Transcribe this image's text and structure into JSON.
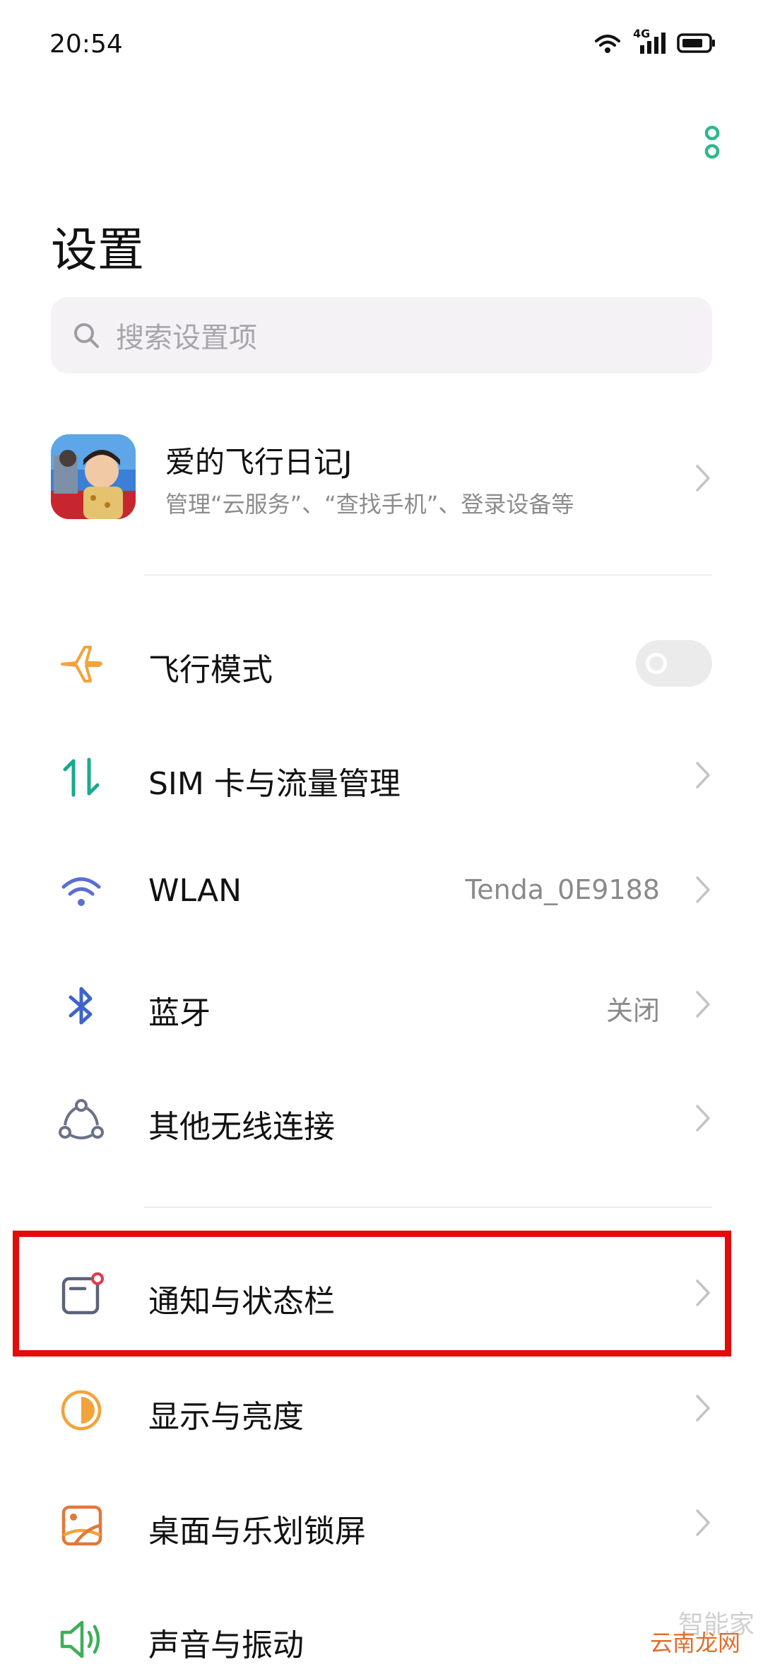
{
  "status_bar": {
    "time": "20:54",
    "network": "4G"
  },
  "header": {
    "title": "设置",
    "more_icon": "more-vertical-icon"
  },
  "search": {
    "placeholder": "搜索设置项"
  },
  "account": {
    "name": "爱的飞行日记J",
    "subtitle": "管理“云服务”、“查找手机”、登录设备等"
  },
  "settings": {
    "airplane": {
      "label": "飞行模式",
      "icon": "airplane-icon",
      "enabled": false
    },
    "sim": {
      "label": "SIM 卡与流量管理",
      "icon": "data-transfer-icon"
    },
    "wlan": {
      "label": "WLAN",
      "value": "Tenda_0E9188",
      "icon": "wifi-icon"
    },
    "bluetooth": {
      "label": "蓝牙",
      "value": "关闭",
      "icon": "bluetooth-icon"
    },
    "other_wireless": {
      "label": "其他无线连接",
      "icon": "connections-icon"
    },
    "notifications": {
      "label": "通知与状态栏",
      "icon": "notification-icon",
      "highlighted": true
    },
    "display": {
      "label": "显示与亮度",
      "icon": "brightness-icon"
    },
    "wallpaper": {
      "label": "桌面与乐划锁屏",
      "icon": "wallpaper-icon"
    },
    "sound": {
      "label": "声音与振动",
      "icon": "speaker-icon"
    }
  },
  "watermark": {
    "line1": "智能家",
    "line2": "云南龙网"
  },
  "colors": {
    "accent_green": "#2bb88a",
    "highlight_red": "#e30c0c",
    "airplane_orange": "#f2a33b",
    "sim_teal": "#19a98e",
    "wifi_blue": "#5a6fd1",
    "bluetooth_blue": "#3f63c9"
  }
}
